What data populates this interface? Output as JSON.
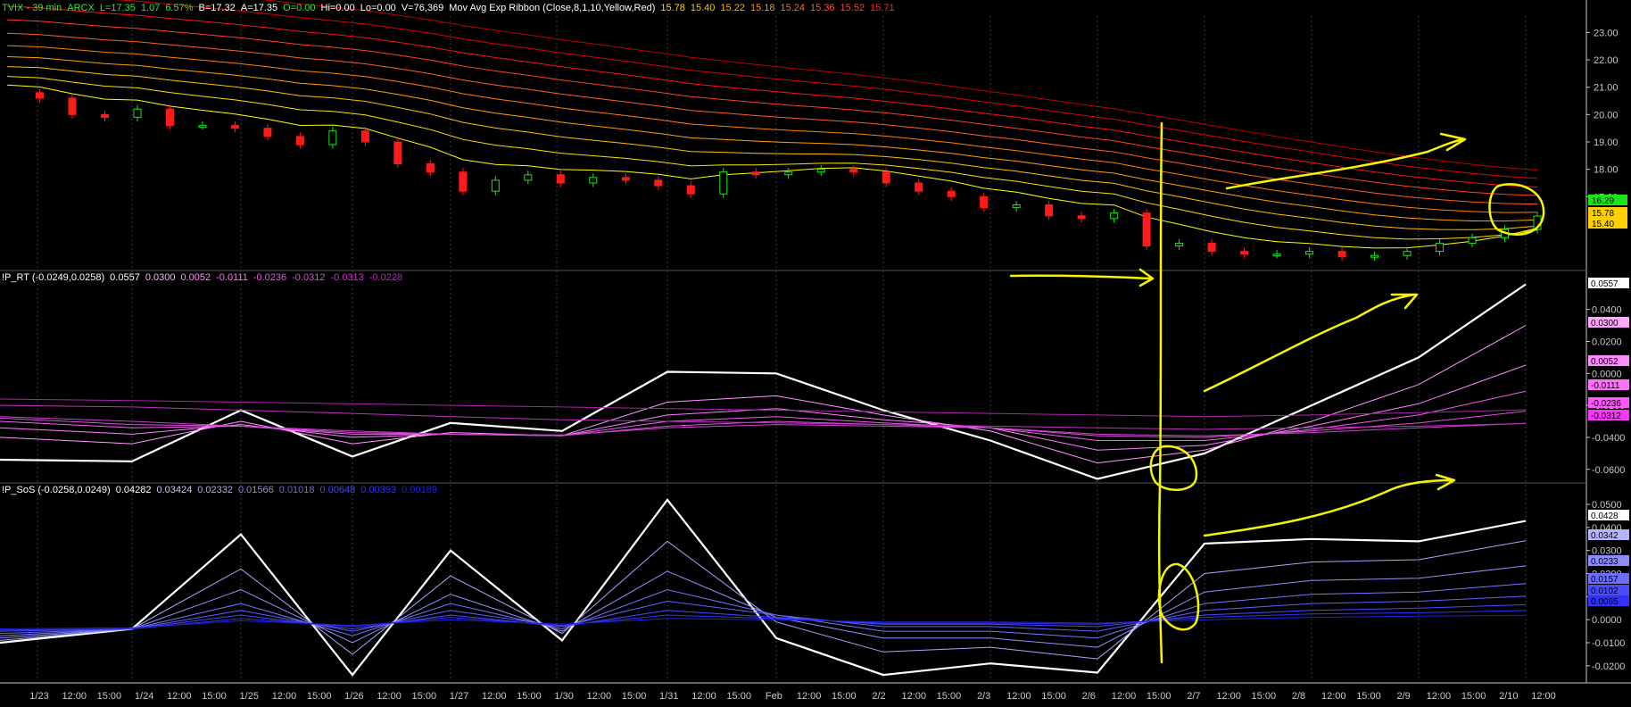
{
  "colors": {
    "background": "#000000",
    "axis": "#c8c8c8",
    "grid": "#3a3a3a",
    "up": "#19e619",
    "down": "#ff1a1a",
    "annotation": "#f5f500",
    "hdr_white": "#ffffff",
    "hdr_green": "#2ee82e",
    "hdr_red": "#ff3b3b"
  },
  "panel1": {
    "header": {
      "symbol": "TVIX - 39 min",
      "exchange": "ARCX",
      "last": "L=17.35",
      "change": "1.07",
      "pct": "6.57%",
      "bid": "B=17.32",
      "ask": "A=17.35",
      "open": "O=0.00",
      "hi": "Hi=0.00",
      "lo": "Lo=0.00",
      "vol": "V=76,369",
      "study": "Mov Avg Exp Ribbon (Close,8,1,10,Yellow,Red)",
      "ribbon_values": [
        "15.78",
        "15.40",
        "15.22",
        "15.18",
        "15.24",
        "15.36",
        "15.52",
        "15.71"
      ]
    },
    "y_ticks": [
      "23.00",
      "22.00",
      "21.00",
      "20.00",
      "19.00",
      "18.00",
      "17.00"
    ],
    "price_labels": [
      "16.29",
      "15.78",
      "15.40"
    ]
  },
  "panel2": {
    "header": {
      "name": "!P_RT (-0.0249,0.0258)",
      "values": [
        "0.0557",
        "0.0300",
        "0.0052",
        "-0.0111",
        "-0.0236",
        "-0.0312",
        "-0.0313",
        "-0.0228"
      ]
    },
    "y_ticks": [
      "0.0400",
      "0.0200",
      "0.0000",
      "-0.0200",
      "-0.0400",
      "-0.0600"
    ],
    "value_labels": [
      "0.0557",
      "0.0300",
      "0.0052",
      "-0.0111",
      "-0.0236",
      "-0.0312"
    ]
  },
  "panel3": {
    "header": {
      "name": "!P_SoS (-0.0258,0.0249)",
      "values": [
        "0.04282",
        "0.03424",
        "0.02332",
        "0.01566",
        "0.01018",
        "0.00648",
        "0.00393",
        "0.00189"
      ]
    },
    "y_ticks": [
      "0.0500",
      "0.0400",
      "0.0300",
      "0.0200",
      "0.0100",
      "0.0000",
      "-0.0100",
      "-0.0200"
    ],
    "value_labels": [
      "0.0428",
      "0.0342",
      "0.0233",
      "0.0157",
      "0.0102",
      "0.0065"
    ]
  },
  "x_labels": [
    "1/23",
    "12:00",
    "15:00",
    "1/24",
    "12:00",
    "15:00",
    "1/25",
    "12:00",
    "15:00",
    "1/26",
    "12:00",
    "15:00",
    "1/27",
    "12:00",
    "15:00",
    "1/30",
    "12:00",
    "15:00",
    "1/31",
    "12:00",
    "15:00",
    "Feb",
    "12:00",
    "15:00",
    "2/2",
    "12:00",
    "15:00",
    "2/3",
    "12:00",
    "15:00",
    "2/6",
    "12:00",
    "15:00",
    "2/7",
    "12:00",
    "15:00",
    "2/8",
    "12:00",
    "15:00",
    "2/9",
    "12:00",
    "15:00",
    "2/10",
    "12:00"
  ],
  "chart_data": [
    {
      "type": "candlestick",
      "title": "TVIX - 39 min",
      "ylim": [
        14.4,
        23.6
      ],
      "ribbon_last": [
        15.78,
        15.4,
        15.22,
        15.18,
        15.24,
        15.36,
        15.52,
        15.71
      ],
      "close_path": [
        20.8,
        20.6,
        20.0,
        19.9,
        20.2,
        19.6,
        19.6,
        19.5,
        19.2,
        18.9,
        19.4,
        19.0,
        18.2,
        17.9,
        17.2,
        17.6,
        17.8,
        17.5,
        17.7,
        17.6,
        17.4,
        17.1,
        17.9,
        17.8,
        17.9,
        18.0,
        17.9,
        17.5,
        17.2,
        17.0,
        16.6,
        16.7,
        16.3,
        16.2,
        16.4,
        15.2,
        15.3,
        15.0,
        14.9,
        14.9,
        15.0,
        14.8,
        14.85,
        15.0,
        15.3,
        15.5,
        15.8,
        16.29
      ]
    },
    {
      "type": "line",
      "title": "!P_RT (-0.0249,0.0258)",
      "ylim": [
        -0.078,
        0.056
      ],
      "x": [
        0,
        1,
        2,
        3,
        4,
        5,
        6,
        7,
        8,
        9,
        10,
        11,
        12,
        13,
        14
      ],
      "series": [
        {
          "values": [
            -0.054,
            -0.055,
            -0.023,
            -0.052,
            -0.031,
            -0.036,
            0.001,
            0.0,
            -0.023,
            -0.042,
            -0.066,
            -0.05,
            -0.02,
            0.01,
            0.0557
          ]
        },
        {
          "values": [
            -0.04,
            -0.044,
            -0.03,
            -0.044,
            -0.037,
            -0.039,
            -0.018,
            -0.014,
            -0.026,
            -0.036,
            -0.056,
            -0.048,
            -0.03,
            -0.007,
            0.03
          ]
        },
        {
          "values": [
            -0.034,
            -0.038,
            -0.032,
            -0.04,
            -0.038,
            -0.039,
            -0.026,
            -0.022,
            -0.029,
            -0.034,
            -0.048,
            -0.045,
            -0.033,
            -0.019,
            0.0052
          ]
        },
        {
          "values": [
            -0.03,
            -0.034,
            -0.033,
            -0.038,
            -0.038,
            -0.039,
            -0.03,
            -0.027,
            -0.031,
            -0.034,
            -0.042,
            -0.042,
            -0.035,
            -0.026,
            -0.0111
          ]
        },
        {
          "values": [
            -0.028,
            -0.032,
            -0.033,
            -0.037,
            -0.038,
            -0.039,
            -0.033,
            -0.03,
            -0.032,
            -0.034,
            -0.039,
            -0.04,
            -0.036,
            -0.031,
            -0.0236
          ]
        },
        {
          "values": [
            -0.027,
            -0.03,
            -0.033,
            -0.036,
            -0.038,
            -0.0385,
            -0.034,
            -0.032,
            -0.033,
            -0.034,
            -0.038,
            -0.039,
            -0.037,
            -0.034,
            -0.0312
          ]
        },
        {
          "values": [
            -0.02,
            -0.021,
            -0.023,
            -0.025,
            -0.027,
            -0.029,
            -0.03,
            -0.031,
            -0.032,
            -0.033,
            -0.034,
            -0.035,
            -0.034,
            -0.033,
            -0.0313
          ]
        },
        {
          "values": [
            -0.016,
            -0.017,
            -0.018,
            -0.019,
            -0.02,
            -0.021,
            -0.022,
            -0.023,
            -0.024,
            -0.025,
            -0.026,
            -0.027,
            -0.026,
            -0.0245,
            -0.0228
          ]
        }
      ]
    },
    {
      "type": "line",
      "title": "!P_SoS (-0.0258,0.0249)",
      "ylim": [
        -0.0255,
        0.0535
      ],
      "x": [
        0,
        1,
        2,
        3,
        4,
        5,
        6,
        7,
        8,
        9,
        10,
        11,
        12,
        13,
        14
      ],
      "series": [
        {
          "values": [
            -0.01,
            -0.004,
            0.037,
            -0.024,
            0.03,
            -0.009,
            0.052,
            -0.008,
            -0.024,
            -0.019,
            -0.023,
            0.033,
            0.035,
            0.034,
            0.04282
          ]
        },
        {
          "values": [
            -0.009,
            -0.004,
            0.022,
            -0.015,
            0.019,
            -0.006,
            0.034,
            -0.001,
            -0.014,
            -0.012,
            -0.017,
            0.02,
            0.025,
            0.026,
            0.03424
          ]
        },
        {
          "values": [
            -0.008,
            -0.004,
            0.013,
            -0.01,
            0.011,
            -0.005,
            0.021,
            0.001,
            -0.008,
            -0.008,
            -0.012,
            0.012,
            0.017,
            0.018,
            0.02332
          ]
        },
        {
          "values": [
            -0.007,
            -0.004,
            0.007,
            -0.007,
            0.007,
            -0.004,
            0.013,
            0.002,
            -0.005,
            -0.005,
            -0.008,
            0.007,
            0.011,
            0.012,
            0.01566
          ]
        },
        {
          "values": [
            -0.006,
            -0.004,
            0.004,
            -0.005,
            0.004,
            -0.003,
            0.008,
            0.002,
            -0.003,
            -0.003,
            -0.005,
            0.004,
            0.007,
            0.008,
            0.01018
          ]
        },
        {
          "values": [
            -0.005,
            -0.004,
            0.002,
            -0.004,
            0.002,
            -0.003,
            0.004,
            0.001,
            -0.002,
            -0.002,
            -0.003,
            0.002,
            0.004,
            0.005,
            0.00648
          ]
        },
        {
          "values": [
            -0.0045,
            -0.004,
            0.0005,
            -0.003,
            0.001,
            -0.0025,
            0.002,
            0.0005,
            -0.0015,
            -0.0015,
            -0.002,
            0.001,
            0.0025,
            0.003,
            0.00393
          ]
        },
        {
          "values": [
            -0.004,
            -0.0035,
            -0.0005,
            -0.0025,
            0.0,
            -0.002,
            0.0005,
            0.0,
            -0.001,
            -0.001,
            -0.0015,
            0.0,
            0.001,
            0.0015,
            0.00189
          ]
        }
      ]
    }
  ]
}
